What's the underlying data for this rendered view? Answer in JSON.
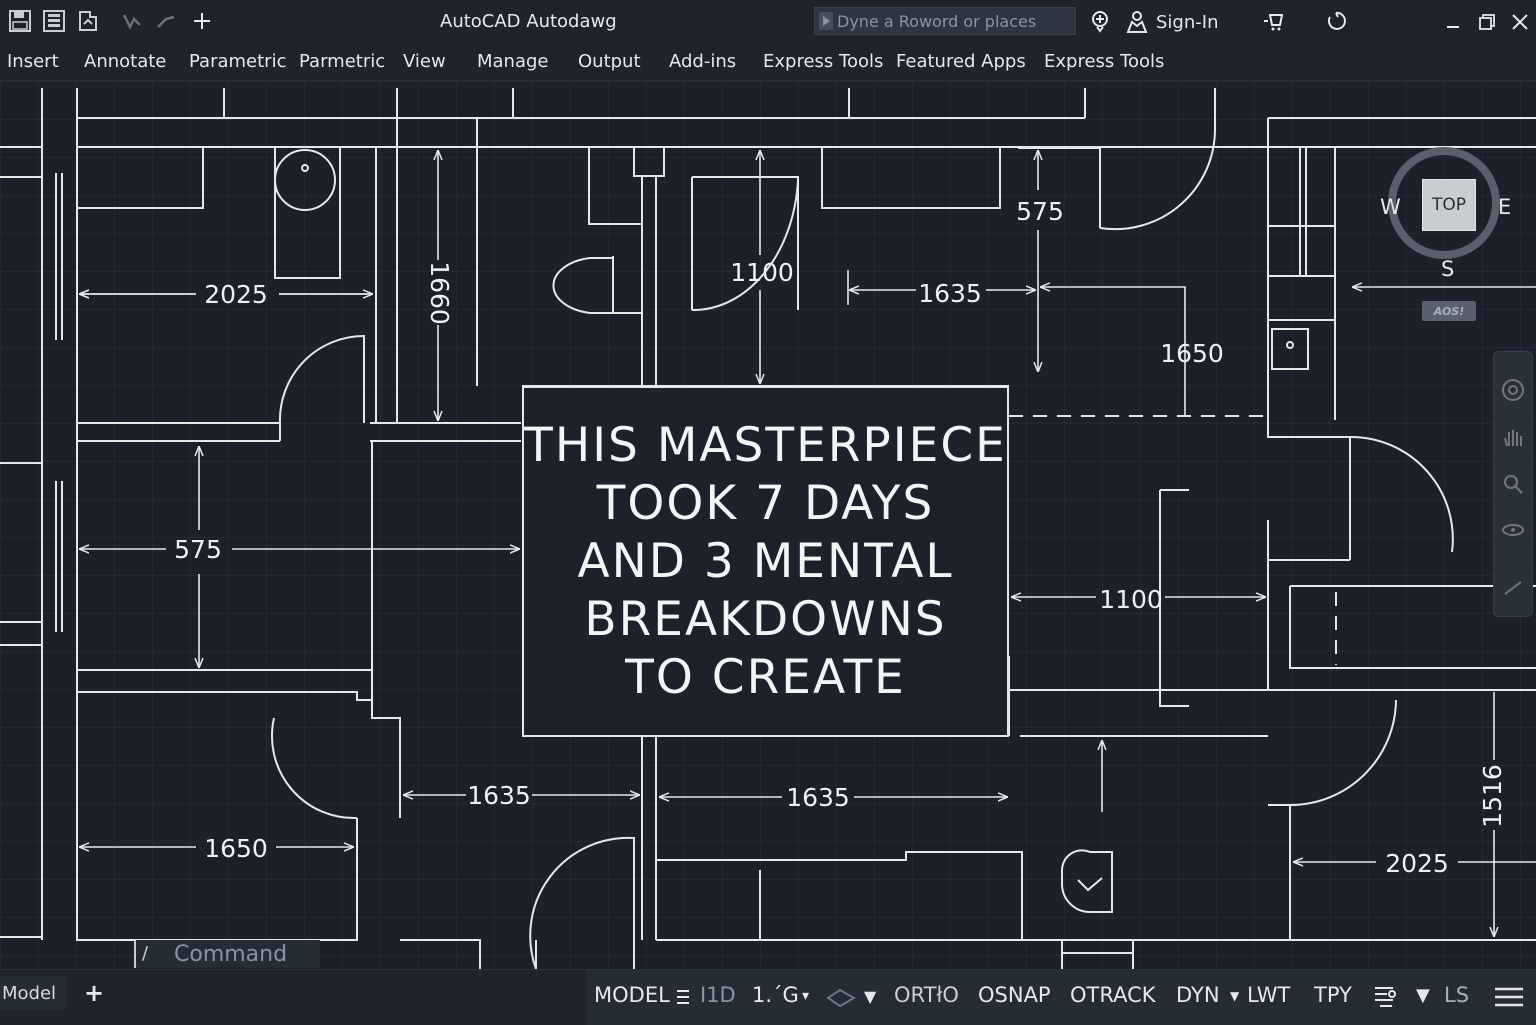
{
  "titlebar": {
    "app_title": "AutoCAD Autodawg",
    "search_placeholder": "Dyne a Roword or places",
    "signin_label": "Sign-In"
  },
  "ribbon": {
    "tabs": [
      "Insert",
      "Annotate",
      "Parametric",
      "Parmetric",
      "View",
      "Manage",
      "Output",
      "Add-ins",
      "Express Tools",
      "Featured Apps",
      "Express Tools"
    ]
  },
  "drawing": {
    "dimensions": {
      "d_2025_top": "2025",
      "d_1660_vert": "1660",
      "d_1100_top": "1100",
      "d_575_top": "575",
      "d_1635_top": "1635",
      "d_1650_right": "1650",
      "d_575_left": "575",
      "d_1100_mid": "1100",
      "d_1635_bl": "1635",
      "d_1635_bm": "1635",
      "d_1650_bl": "1650",
      "d_1516_vert": "1516",
      "d_2025_br": "2025"
    },
    "center_text": [
      "THIS MASTERPIECE",
      "TOOK 7 DAYS",
      "AND 3 MENTAL",
      "BREAKDOWNS",
      "TO CREATE"
    ]
  },
  "viewcube": {
    "top_label": "TOP",
    "west": "W",
    "east": "E",
    "south": "S",
    "wcs_label": "AOS!"
  },
  "command": {
    "prompt_glyph": "/",
    "placeholder": "Command"
  },
  "statusbar": {
    "layout_tab": "Model",
    "add_tab": "+",
    "items": {
      "model": "MODEL",
      "grid": "I1D",
      "scale": "1.´G",
      "ortho": "ORTłO",
      "osnap": "OSNAP",
      "otrack": "OTRACK",
      "dyn": "DYN",
      "lwt": "LWT",
      "tpy": "TPY",
      "ls": "LS"
    }
  },
  "colors": {
    "background": "#1b202a",
    "chrome": "#1e232c",
    "line": "#e6e8ec",
    "text": "#eef1f4"
  }
}
